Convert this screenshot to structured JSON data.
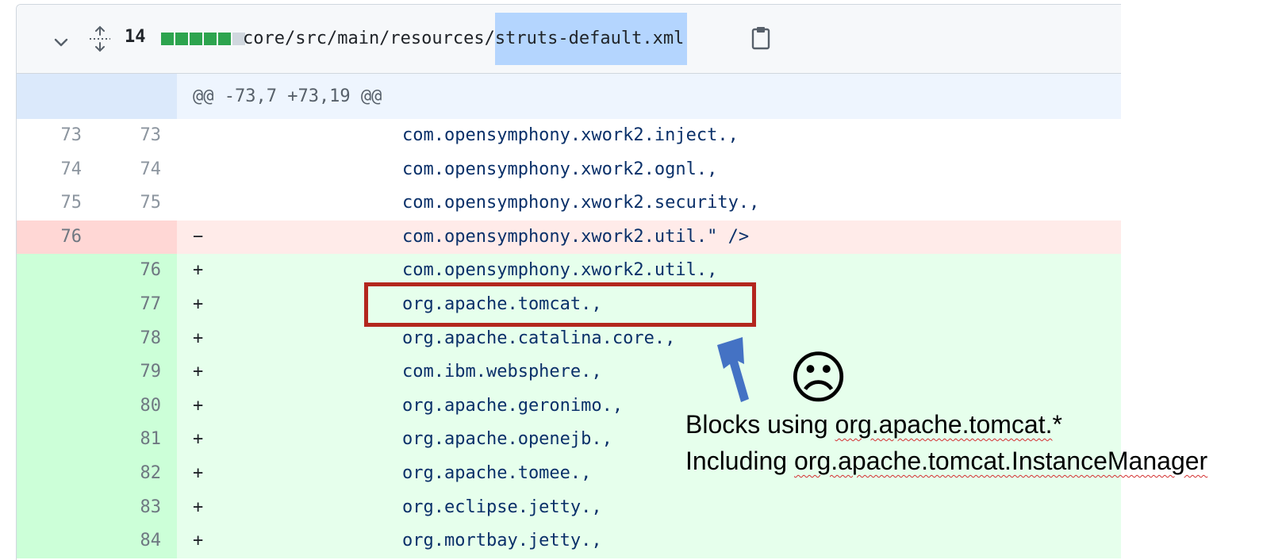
{
  "file_header": {
    "changes_count": "14",
    "diffstat": [
      "add",
      "add",
      "add",
      "add",
      "add",
      "neutral"
    ],
    "path_prefix": "core/src/main/resources/",
    "path_selected": "struts-default.xml"
  },
  "hunk_header": "@@ -73,7 +73,19 @@",
  "lines": [
    {
      "type": "ctx",
      "old": "73",
      "new": "73",
      "sign": "",
      "text": "com.opensymphony.xwork2.inject.,"
    },
    {
      "type": "ctx",
      "old": "74",
      "new": "74",
      "sign": "",
      "text": "com.opensymphony.xwork2.ognl.,"
    },
    {
      "type": "ctx",
      "old": "75",
      "new": "75",
      "sign": "",
      "text": "com.opensymphony.xwork2.security.,"
    },
    {
      "type": "del",
      "old": "76",
      "new": "",
      "sign": "−",
      "text": "com.opensymphony.xwork2.util.\" />"
    },
    {
      "type": "add",
      "old": "",
      "new": "76",
      "sign": "+",
      "text": "com.opensymphony.xwork2.util.,"
    },
    {
      "type": "add",
      "old": "",
      "new": "77",
      "sign": "+",
      "text": "org.apache.tomcat.,"
    },
    {
      "type": "add",
      "old": "",
      "new": "78",
      "sign": "+",
      "text": "org.apache.catalina.core.,"
    },
    {
      "type": "add",
      "old": "",
      "new": "79",
      "sign": "+",
      "text": "com.ibm.websphere.,"
    },
    {
      "type": "add",
      "old": "",
      "new": "80",
      "sign": "+",
      "text": "org.apache.geronimo.,"
    },
    {
      "type": "add",
      "old": "",
      "new": "81",
      "sign": "+",
      "text": "org.apache.openejb.,"
    },
    {
      "type": "add",
      "old": "",
      "new": "82",
      "sign": "+",
      "text": "org.apache.tomee.,"
    },
    {
      "type": "add",
      "old": "",
      "new": "83",
      "sign": "+",
      "text": "org.eclipse.jetty.,"
    },
    {
      "type": "add",
      "old": "",
      "new": "84",
      "sign": "+",
      "text": "org.mortbay.jetty.,"
    }
  ],
  "annotation": {
    "face": "☹",
    "line1_prefix": "Blocks using ",
    "line1_term": "org.apache.tomcat.",
    "line1_suffix": "*",
    "line2_prefix": "Including ",
    "line2_term": "org.apache.tomcat.InstanceManager"
  },
  "colors": {
    "added_gutter": "#ccffd8",
    "added_code": "#e6ffec",
    "deleted_gutter": "#ffd7d5",
    "deleted_code": "#ffebe9",
    "hunk_bg": "#eef5fe",
    "highlight_box": "#b3261e",
    "arrow": "#4472c4"
  },
  "icons": [
    "chevron-down-icon",
    "expand-all-icon",
    "expand-up-icon",
    "copy-icon",
    "sad-face-icon"
  ]
}
